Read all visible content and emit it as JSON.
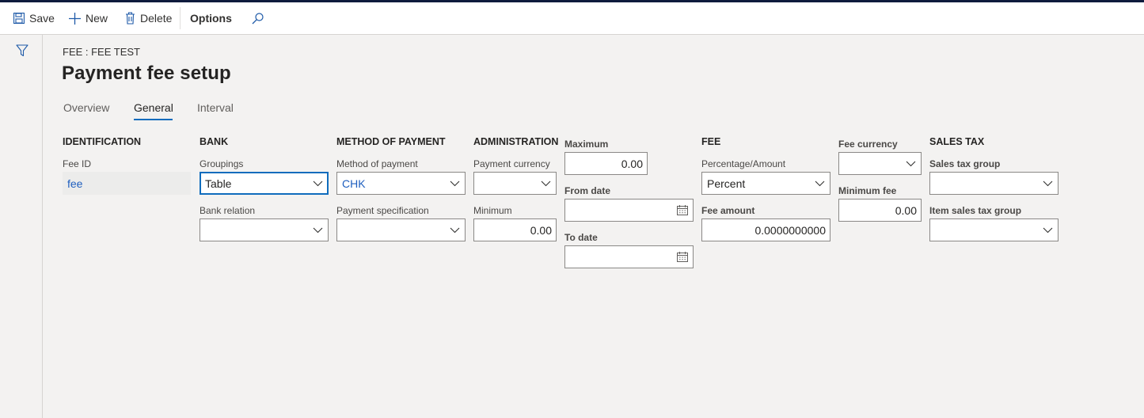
{
  "toolbar": {
    "save_label": "Save",
    "new_label": "New",
    "delete_label": "Delete",
    "options_label": "Options"
  },
  "breadcrumb": "FEE : FEE TEST",
  "title": "Payment fee setup",
  "tabs": [
    {
      "label": "Overview",
      "active": false
    },
    {
      "label": "General",
      "active": true
    },
    {
      "label": "Interval",
      "active": false
    }
  ],
  "groups": {
    "identification": {
      "header": "IDENTIFICATION",
      "fee_id_label": "Fee ID",
      "fee_id_value": "fee"
    },
    "bank": {
      "header": "BANK",
      "groupings_label": "Groupings",
      "groupings_value": "Table",
      "bank_relation_label": "Bank relation",
      "bank_relation_value": ""
    },
    "method_of_payment": {
      "header": "METHOD OF PAYMENT",
      "method_label": "Method of payment",
      "method_value": "CHK",
      "spec_label": "Payment specification",
      "spec_value": ""
    },
    "administration": {
      "header": "ADMINISTRATION",
      "currency_label": "Payment currency",
      "currency_value": "",
      "minimum_label": "Minimum",
      "minimum_value": "0.00"
    },
    "range": {
      "maximum_label": "Maximum",
      "maximum_value": "0.00",
      "from_date_label": "From date",
      "from_date_value": "",
      "to_date_label": "To date",
      "to_date_value": ""
    },
    "fee": {
      "header": "FEE",
      "pct_amount_label": "Percentage/Amount",
      "pct_amount_value": "Percent",
      "fee_amount_label": "Fee amount",
      "fee_amount_value": "0.0000000000"
    },
    "fee_extra": {
      "fee_currency_label": "Fee currency",
      "fee_currency_value": "",
      "minimum_fee_label": "Minimum fee",
      "minimum_fee_value": "0.00"
    },
    "sales_tax": {
      "header": "SALES TAX",
      "group_label": "Sales tax group",
      "group_value": "",
      "item_group_label": "Item sales tax group",
      "item_group_value": ""
    }
  }
}
